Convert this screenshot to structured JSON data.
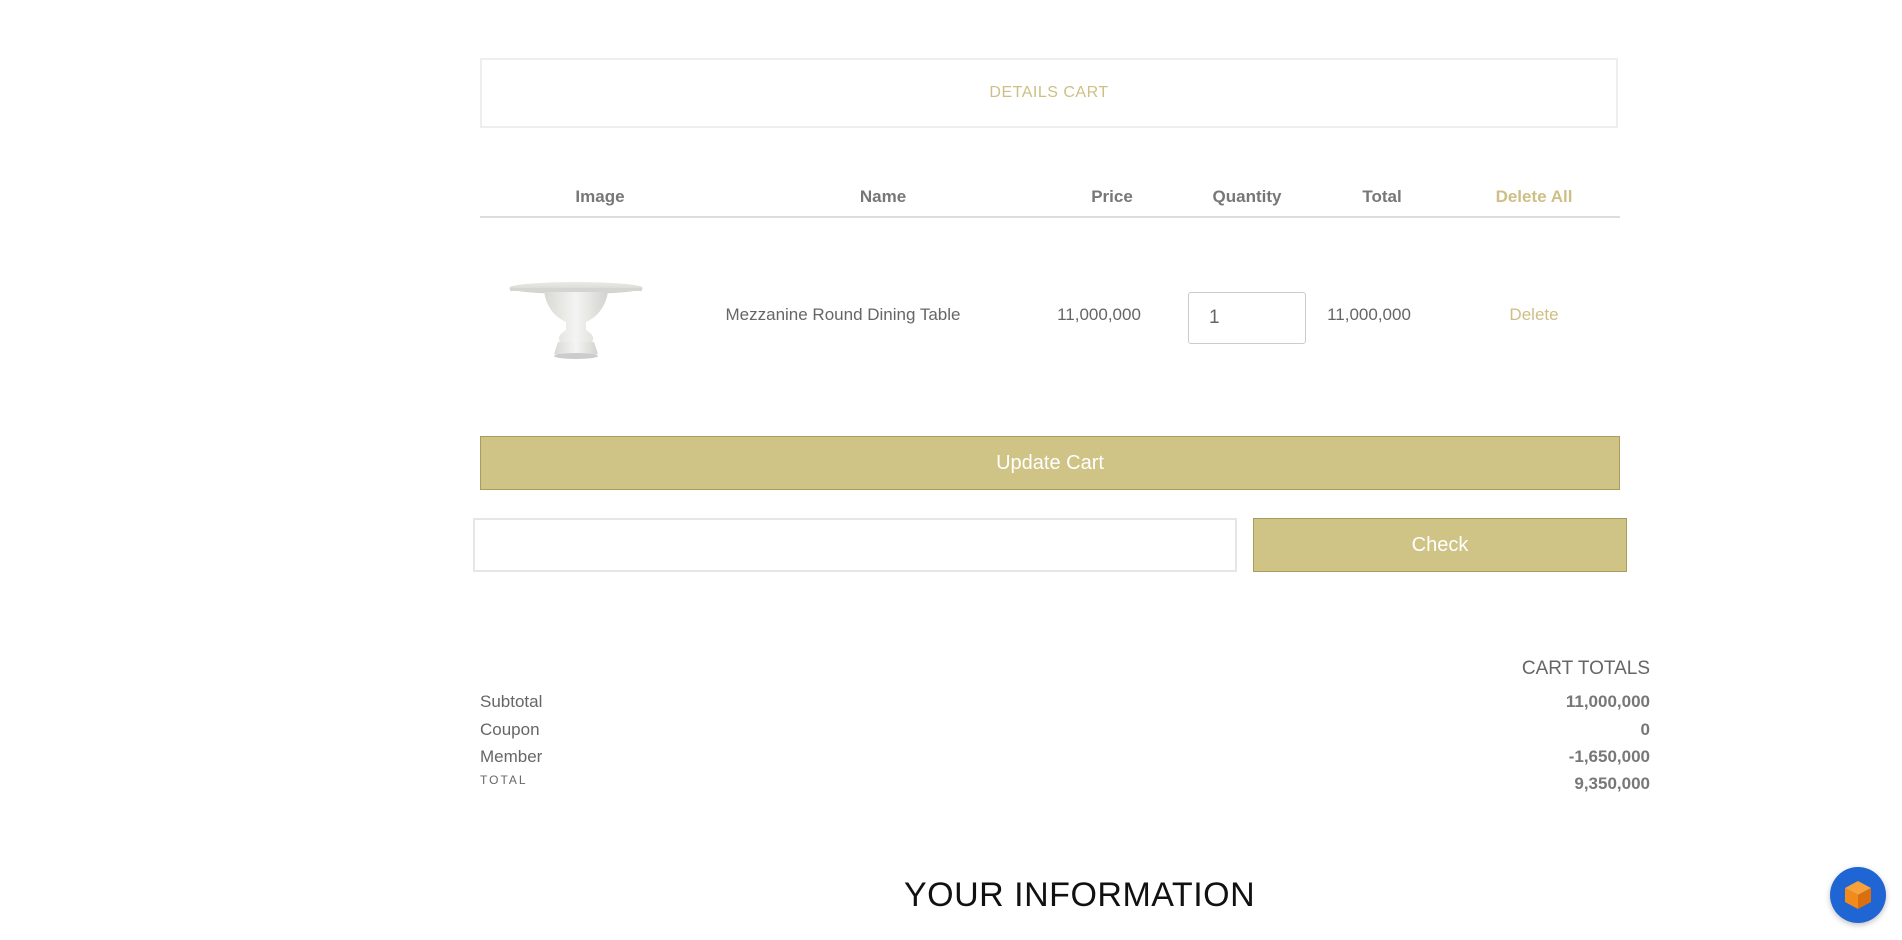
{
  "header": {
    "title": "DETAILS CART"
  },
  "table": {
    "columns": {
      "image": "Image",
      "name": "Name",
      "price": "Price",
      "quantity": "Quantity",
      "total": "Total",
      "delete_all": "Delete All"
    },
    "rows": [
      {
        "image_icon": "table-product-image",
        "name": "Mezzanine Round Dining Table",
        "price": "11,000,000",
        "quantity": "1",
        "total": "11,000,000",
        "delete_label": "Delete"
      }
    ]
  },
  "actions": {
    "update_cart": "Update Cart",
    "coupon_value": "",
    "coupon_placeholder": "",
    "check": "Check"
  },
  "totals": {
    "title": "CART TOTALS",
    "subtotal_label": "Subtotal",
    "subtotal_value": "11,000,000",
    "coupon_label": "Coupon",
    "coupon_value": "0",
    "member_label": "Member",
    "member_value": "-1,650,000",
    "total_label": "TOTAL",
    "total_value": "9,350,000"
  },
  "info": {
    "title": "YOUR INFORMATION"
  },
  "floating": {
    "icon": "cube-icon"
  },
  "colors": {
    "accent_gold": "#cfc386",
    "accent_text": "#cdbf85",
    "float_button": "#1f66d4",
    "cube_orange": "#f28a1c"
  }
}
